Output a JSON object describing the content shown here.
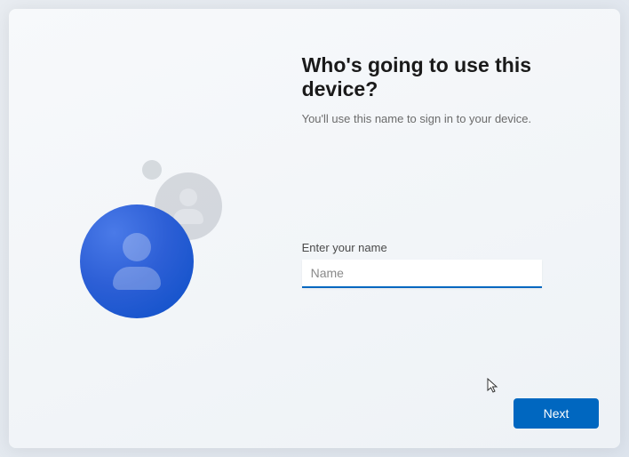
{
  "header": {
    "title": "Who's going to use this device?",
    "subtitle": "You'll use this name to sign in to your device."
  },
  "form": {
    "name_label": "Enter your name",
    "name_placeholder": "Name",
    "name_value": ""
  },
  "actions": {
    "next_label": "Next"
  },
  "icons": {
    "avatar_main": "user-avatar-icon",
    "avatar_back": "user-avatar-icon-ghost"
  },
  "colors": {
    "accent": "#0067c0",
    "avatar_gradient_start": "#4a7ae8",
    "avatar_gradient_end": "#0b4fc7"
  }
}
